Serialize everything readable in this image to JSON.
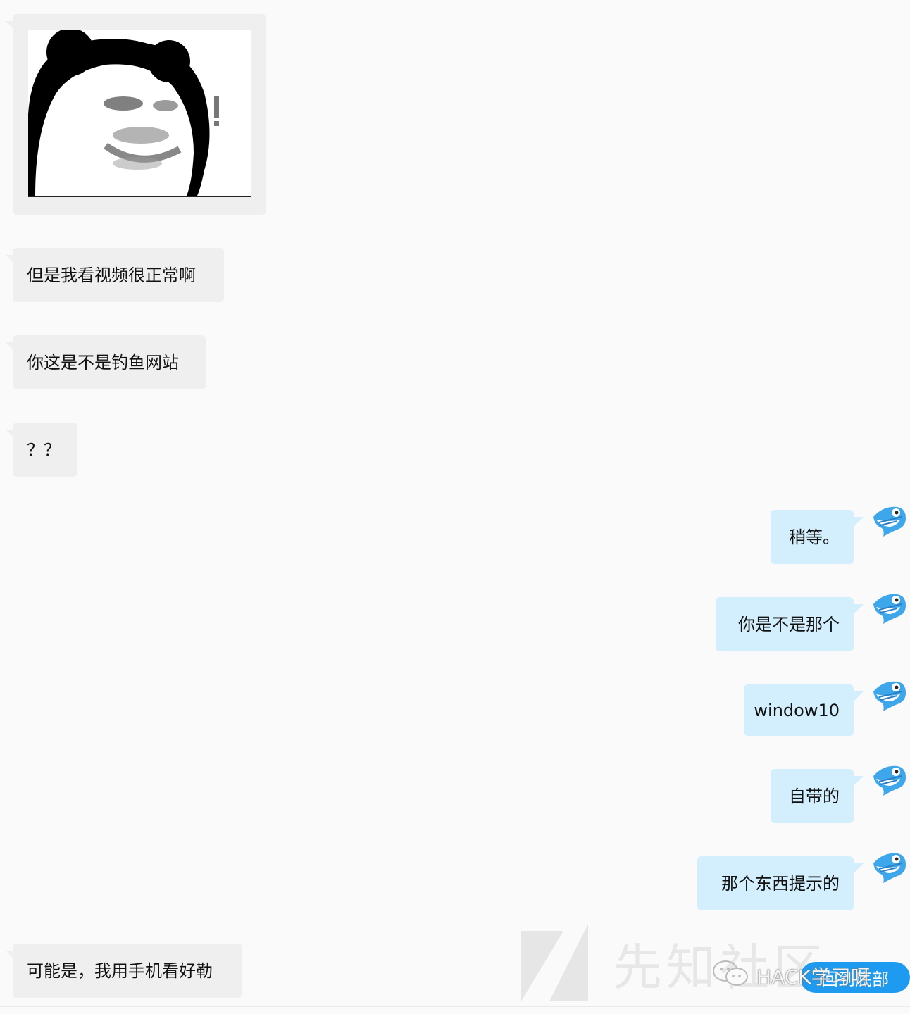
{
  "chat": {
    "sticker": {
      "alt": "panda meme sticker",
      "exclaim": "!"
    },
    "left_messages": [
      "但是我看视频很正常啊",
      "你这是不是钓鱼网站",
      "？？",
      "可能是，我用手机看好勒"
    ],
    "right_messages": [
      "稍等。",
      "你是不是那个",
      "window10",
      "自带的",
      "那个东西提示的"
    ]
  },
  "watermark": {
    "site_text": "先知社区",
    "account_name": "HACK学习呀"
  },
  "buttons": {
    "back_to_bottom": "回到底部"
  },
  "colors": {
    "background": "#fafafa",
    "incoming_bubble": "#efefef",
    "outgoing_bubble": "#d3eefc",
    "button": "#1e9bf0"
  }
}
